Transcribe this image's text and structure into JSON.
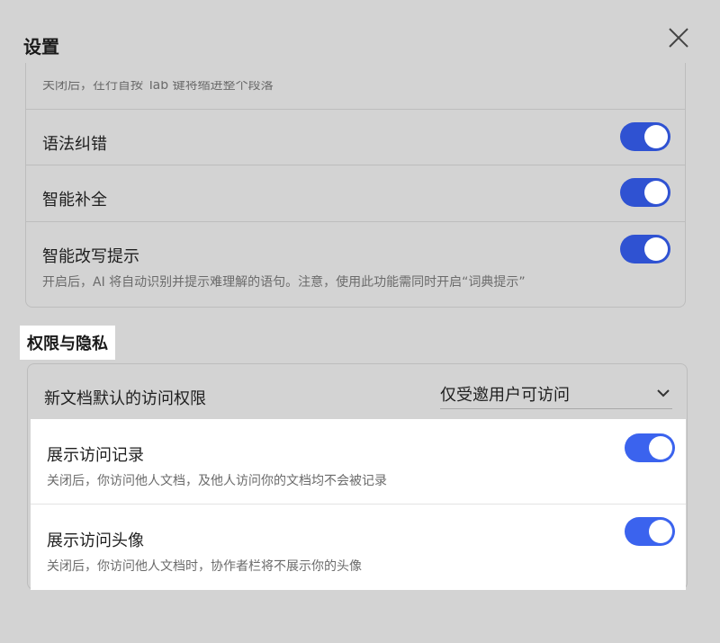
{
  "dialog": {
    "title": "设置"
  },
  "editor_section": {
    "cut_off_text": "关闭后，在行首按 Tab 键将缩进整个段落",
    "items": [
      {
        "label": "语法纠错",
        "enabled": true
      },
      {
        "label": "智能补全",
        "enabled": true
      },
      {
        "label": "智能改写提示",
        "enabled": true,
        "description": "开启后，AI 将自动识别并提示难理解的语句。注意，使用此功能需同时开启“词典提示”"
      }
    ]
  },
  "privacy_section": {
    "title": "权限与隐私",
    "default_permission": {
      "label": "新文档默认的访问权限",
      "selected": "仅受邀用户可访问"
    },
    "items": [
      {
        "label": "展示访问记录",
        "enabled": true,
        "description": "关闭后，你访问他人文档，及他人访问你的文档均不会被记录"
      },
      {
        "label": "展示访问头像",
        "enabled": true,
        "description": "关闭后，你访问他人文档时，协作者栏将不展示你的头像"
      }
    ]
  },
  "colors": {
    "toggle_on": "#2f52d2",
    "toggle_on_bright": "#3b63ee",
    "overlay_bg": "#d3d3d3"
  }
}
